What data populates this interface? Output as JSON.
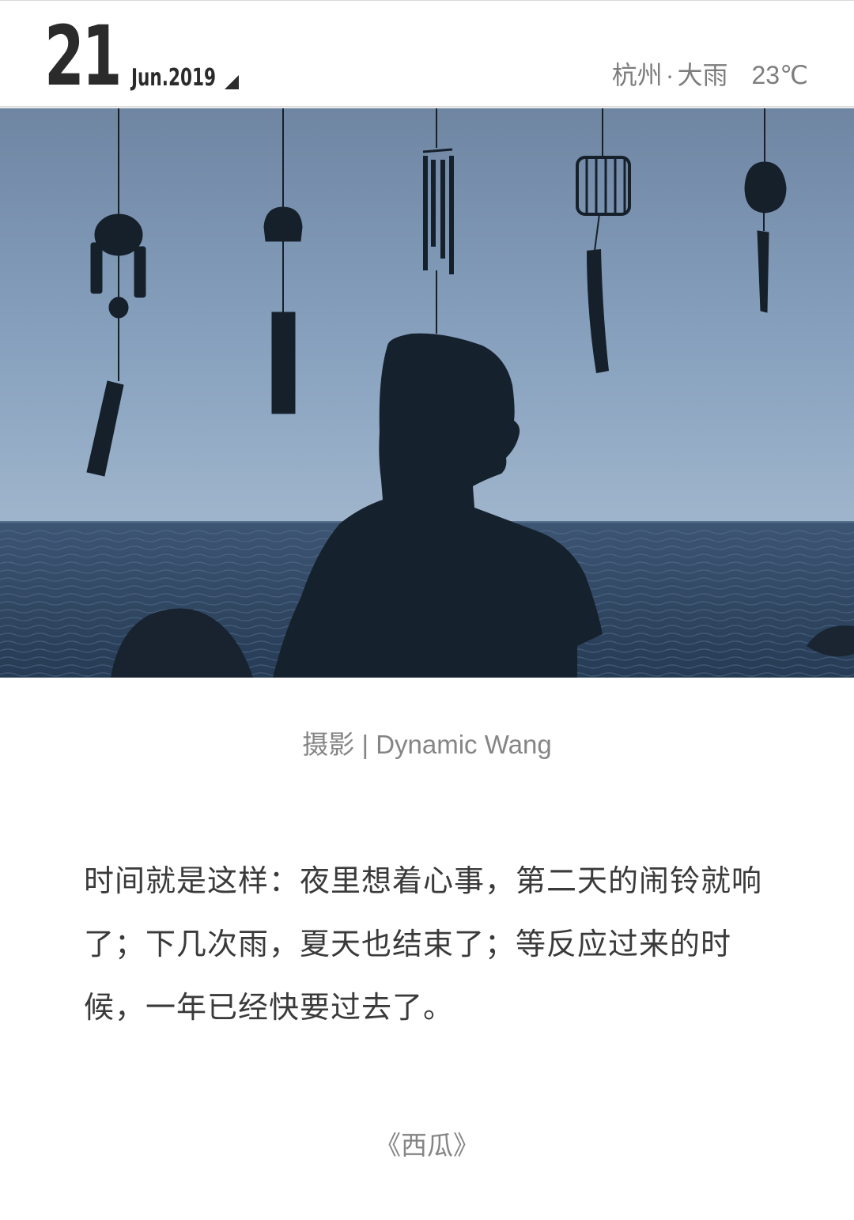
{
  "header": {
    "day": "21",
    "month_year": "Jun.2019",
    "toggle_icon": "triangle-corner-icon",
    "city": "杭州",
    "separator": "·",
    "condition": "大雨",
    "temperature": "23℃"
  },
  "photo": {
    "subject": "hero-photo"
  },
  "caption": {
    "credit": "摄影 | Dynamic Wang",
    "quote": "时间就是这样：夜里想着心事，第二天的闹铃就响了；下几次雨，夏天也结束了；等反应过来的时候，一年已经快要过去了。",
    "source": "《西瓜》"
  },
  "colors": {
    "sky": "#7f9ab6",
    "sea": "#2f4763",
    "silhouette": "#14202c",
    "text_dark": "#3a3a3a",
    "text_muted": "#858585"
  }
}
